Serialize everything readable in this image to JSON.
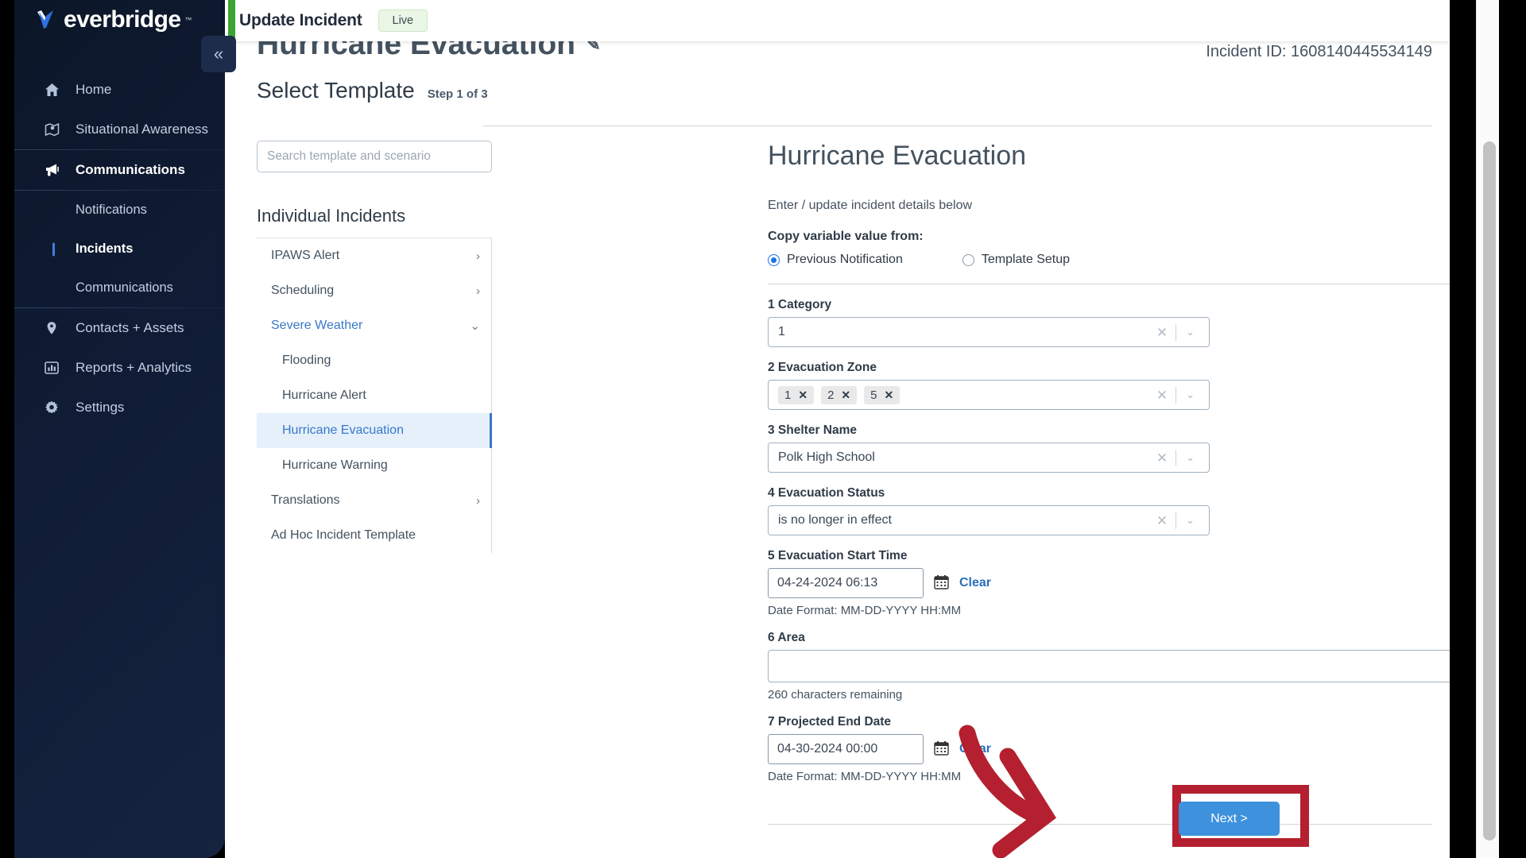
{
  "brand": {
    "name": "everbridge",
    "tm": "™",
    "collapse_icon": "«"
  },
  "sidebar": {
    "items": [
      {
        "label": "Home",
        "icon": "home-icon",
        "active": false
      },
      {
        "label": "Situational Awareness",
        "icon": "map-icon",
        "active": false
      },
      {
        "label": "Communications",
        "icon": "megaphone-icon",
        "active": true
      },
      {
        "label": "Contacts + Assets",
        "icon": "pin-icon",
        "active": false
      },
      {
        "label": "Reports + Analytics",
        "icon": "chart-icon",
        "active": false
      },
      {
        "label": "Settings",
        "icon": "gear-icon",
        "active": false
      }
    ],
    "subitems": [
      {
        "label": "Notifications",
        "active": false
      },
      {
        "label": "Incidents",
        "active": true
      },
      {
        "label": "Communications",
        "active": false
      }
    ]
  },
  "topbar": {
    "page_kind": "Update Incident",
    "status_badge": "Live"
  },
  "header": {
    "incident_title": "Hurricane Evacuation",
    "edit_icon": "✎",
    "incident_id": "Incident ID: 1608140445534149"
  },
  "step": {
    "title": "Select Template",
    "subtitle": "Step 1 of 3"
  },
  "template_panel": {
    "search_placeholder": "Search template and scenario",
    "search_value": "",
    "group_heading": "Individual Incidents",
    "rows": [
      {
        "label": "IPAWS Alert",
        "type": "group",
        "chevron": "›",
        "state": "collapsed"
      },
      {
        "label": "Scheduling",
        "type": "group",
        "chevron": "›",
        "state": "collapsed"
      },
      {
        "label": "Severe Weather",
        "type": "group",
        "chevron": "⌄",
        "state": "open"
      },
      {
        "label": "Flooding",
        "type": "child",
        "chevron": "",
        "state": ""
      },
      {
        "label": "Hurricane Alert",
        "type": "child",
        "chevron": "",
        "state": ""
      },
      {
        "label": "Hurricane Evacuation",
        "type": "child",
        "chevron": "",
        "state": "selected"
      },
      {
        "label": "Hurricane Warning",
        "type": "child",
        "chevron": "",
        "state": ""
      },
      {
        "label": "Translations",
        "type": "group",
        "chevron": "›",
        "state": "collapsed"
      },
      {
        "label": "Ad Hoc Incident Template",
        "type": "group",
        "chevron": "",
        "state": ""
      }
    ]
  },
  "form": {
    "title": "Hurricane Evacuation",
    "subtitle": "Enter / update incident details below",
    "copy_label": "Copy variable value from:",
    "radio_previous": "Previous Notification",
    "radio_template": "Template Setup",
    "fields": {
      "category": {
        "label": "1 Category",
        "value": "1",
        "clear_icon": "✕",
        "caret_icon": "⌄"
      },
      "evacuation_zone": {
        "label": "2 Evacuation Zone",
        "chips": [
          "1",
          "2",
          "5"
        ],
        "chip_remove_icon": "✕",
        "clear_icon": "✕",
        "caret_icon": "⌄"
      },
      "shelter_name": {
        "label": "3 Shelter Name",
        "value": "Polk High School",
        "clear_icon": "✕",
        "caret_icon": "⌄"
      },
      "evacuation_status": {
        "label": "4 Evacuation Status",
        "value": "is no longer in effect",
        "clear_icon": "✕",
        "caret_icon": "⌄"
      },
      "evacuation_start_time": {
        "label": "5 Evacuation Start Time",
        "value": "04-24-2024 06:13",
        "calendar_icon": "▦",
        "clear_label": "Clear",
        "helper": "Date Format: MM-DD-YYYY HH:MM"
      },
      "area": {
        "label": "6 Area",
        "value": "",
        "helper": "260 characters remaining"
      },
      "projected_end_date": {
        "label": "7 Projected End Date",
        "value": "04-30-2024 00:00",
        "calendar_icon": "▦",
        "clear_label": "Clear",
        "helper": "Date Format: MM-DD-YYYY HH:MM"
      }
    },
    "next_button": "Next >"
  },
  "colors": {
    "sidebar_bg": "#0f1b31",
    "accent_green": "#3aa435",
    "link_blue": "#3878c8",
    "primary_button": "#3d91dd",
    "annotation_red": "#b4202f",
    "selected_row_bg": "#e5f0fb"
  }
}
